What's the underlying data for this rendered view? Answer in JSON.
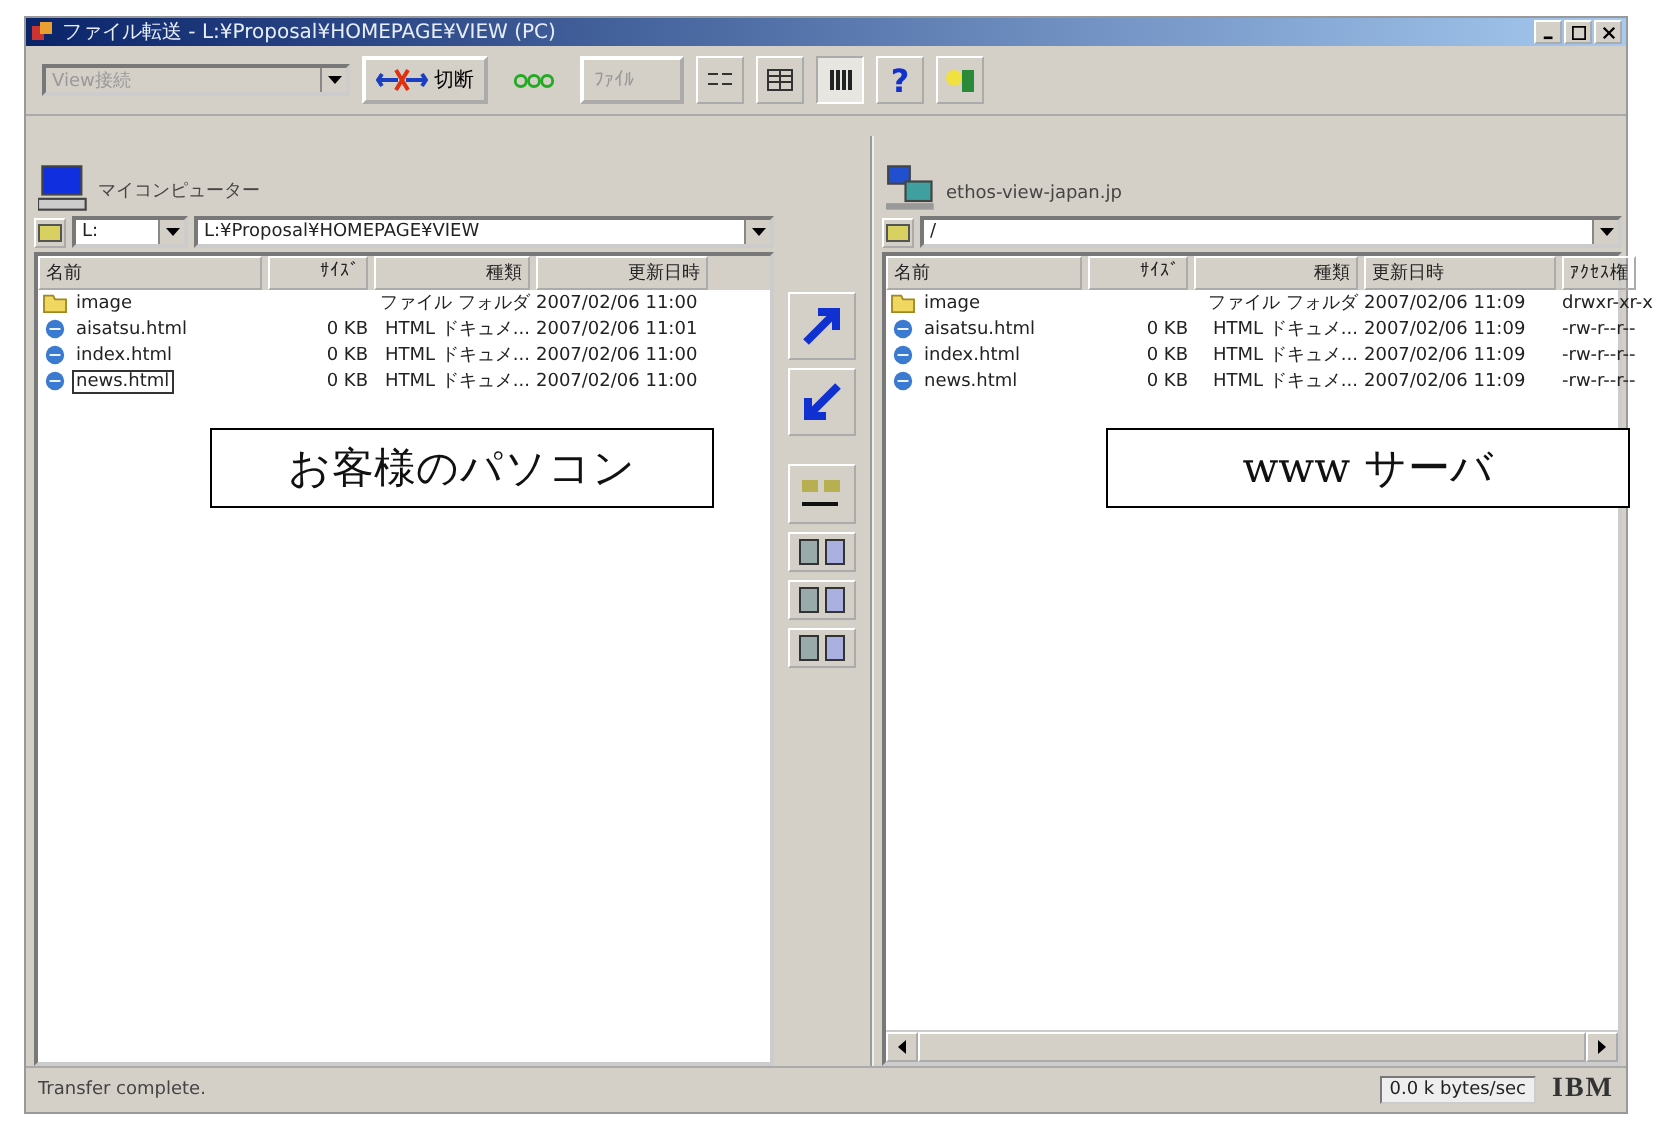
{
  "window": {
    "title": "ファイル転送 - L:¥Proposal¥HOMEPAGE¥VIEW (PC)"
  },
  "toolbar": {
    "profile": "View接続",
    "disconnect": "切断",
    "file_button": "ﾌｧｲﾙ",
    "help": "?"
  },
  "left": {
    "label": "マイコンピューター",
    "drive": "L: ",
    "path": "L:¥Proposal¥HOMEPAGE¥VIEW",
    "columns": [
      "名前",
      "ｻｲｽﾞ",
      "種類",
      "更新日時"
    ],
    "rows": [
      {
        "kind": "folder",
        "name": "image",
        "size": "",
        "type": "ファイル フォルダ",
        "date": "2007/02/06 11:00",
        "selected": false
      },
      {
        "kind": "html",
        "name": "aisatsu.html",
        "size": "0 KB",
        "type": "HTML ドキュメ...",
        "date": "2007/02/06 11:01",
        "selected": false
      },
      {
        "kind": "html",
        "name": "index.html",
        "size": "0 KB",
        "type": "HTML ドキュメ...",
        "date": "2007/02/06 11:00",
        "selected": false
      },
      {
        "kind": "html",
        "name": "news.html",
        "size": "0 KB",
        "type": "HTML ドキュメ...",
        "date": "2007/02/06 11:00",
        "selected": true
      }
    ]
  },
  "right": {
    "label": "ethos-view-japan.jp",
    "path": "/",
    "columns": [
      "名前",
      "ｻｲｽﾞ",
      "種類",
      "更新日時",
      "ｱｸｾｽ権"
    ],
    "rows": [
      {
        "kind": "folder",
        "name": "image",
        "size": "",
        "type": "ファイル フォルダ",
        "date": "2007/02/06 11:09",
        "access": "drwxr-xr-x"
      },
      {
        "kind": "html",
        "name": "aisatsu.html",
        "size": "0 KB",
        "type": "HTML ドキュメ...",
        "date": "2007/02/06 11:09",
        "access": "-rw-r--r--"
      },
      {
        "kind": "html",
        "name": "index.html",
        "size": "0 KB",
        "type": "HTML ドキュメ...",
        "date": "2007/02/06 11:09",
        "access": "-rw-r--r--"
      },
      {
        "kind": "html",
        "name": "news.html",
        "size": "0 KB",
        "type": "HTML ドキュメ...",
        "date": "2007/02/06 11:09",
        "access": "-rw-r--r--"
      }
    ]
  },
  "callouts": [
    "お客様のパソコン",
    "www サーバ"
  ],
  "status_bar": {
    "message": "Transfer complete.",
    "rate": "0.0 k bytes/sec",
    "logo": "IBM"
  }
}
